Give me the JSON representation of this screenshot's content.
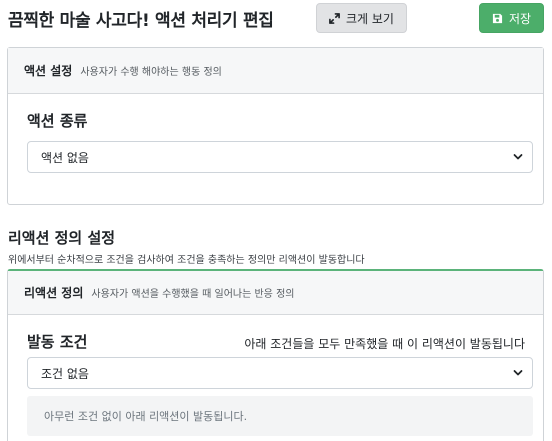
{
  "header": {
    "title": "끔찍한 마술 사고다! 액션 처리기 편집",
    "expand_label": "크게 보기",
    "save_label": "저장",
    "expand_icon": "expand-arrows-icon",
    "save_icon": "floppy-disk-icon"
  },
  "action_card": {
    "title": "액션 설정",
    "description": "사용자가 수행 해야하는 행동 정의",
    "field_label": "액션 종류",
    "select_value": "액션 없음"
  },
  "reaction_section": {
    "title": "리액션 정의 설정",
    "description": "위에서부터 순차적으로 조건을 검사하여 조건을 충족하는 정의만 리액션이 발동합니다"
  },
  "reaction_card": {
    "title": "리액션 정의",
    "description": "사용자가 액션을 수행했을 때 일어나는 반응 정의",
    "condition_label": "발동 조건",
    "condition_note": "아래 조건들을 모두 만족했을 때 이 리액션이 발동됩니다",
    "condition_select_value": "조건 없음",
    "info_text": "아무런 조건 없이 아래 리액션이 발동됩니다."
  },
  "colors": {
    "save_button": "#4cae6a",
    "expand_button": "#e2e3e5",
    "reaction_card_accent": "#5bb37a"
  }
}
